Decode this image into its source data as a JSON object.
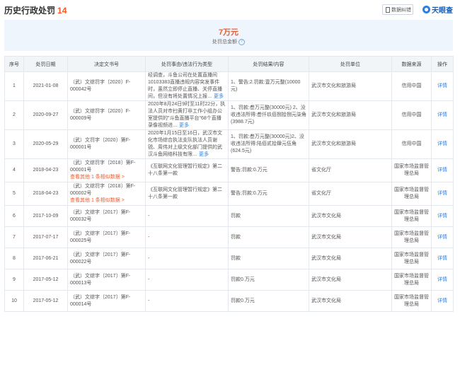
{
  "header": {
    "title": "历史行政处罚",
    "count": "14",
    "report_button": "数据纠错",
    "brand": "天眼查"
  },
  "summary": {
    "amount": "7万元",
    "label": "处罚总金额"
  },
  "table": {
    "columns": [
      "序号",
      "处罚日期",
      "决定文书号",
      "处罚事由/违法行为类型",
      "处罚结果/内容",
      "处罚单位",
      "数据来源",
      "操作"
    ],
    "rows": [
      {
        "idx": "1",
        "date": "2021-01-08",
        "docno": "（武）文综罚字〔2020〕F-000042号",
        "docno_extra": "",
        "reason": "经调查，斗鱼公司在处置直播间10103383直播违规内容突发事件时，虽然立即停止直播、关停直播间，但没有将处置情况上报…",
        "reason_more": "更多",
        "result": "1、警告;2.罚款:壹万元整(10000元)",
        "unit": "武汉市文化和旅游局",
        "source": "信用中国",
        "op": "详情"
      },
      {
        "idx": "2",
        "date": "2020-09-27",
        "docno": "（武）文综罚字〔2020〕F-000009号",
        "docno_extra": "",
        "reason": "2020年8月24日9时至11时22分，执法人员对市扫黄打非工作小组办公室提供的\"斗鱼直播平台\"68个直播录像视频进…",
        "reason_more": "更多",
        "result": "1、罚款:叁万元整(30000元) 2、没收违法所得:叁仟玖佰捌拾捌元柒角(3988.7元)",
        "unit": "武汉市文化和旅游局",
        "source": "信用中国",
        "op": "详情"
      },
      {
        "idx": "3",
        "date": "2020-05-29",
        "docno": "（武）文罚字〔2020〕第F-000001号",
        "docno_extra": "",
        "reason": "2020年1月15日至16日，武汉市文化市场综合执法支队执法人员谢锐、周伟对上级文化部门提供的武汉斗鱼网络科技有限…",
        "reason_more": "更多",
        "result": "1、罚款:叁万元整(30000元)2、没收违法所得:陆佰贰拾肆元伍角(624.5元)",
        "unit": "武汉市文化和旅游局",
        "source": "信用中国",
        "op": "详情"
      },
      {
        "idx": "4",
        "date": "2018-04-23",
        "docno": "（武）文综罚字〔2018〕第F-000001号",
        "docno_extra": "查看其他 1 条相似数据 >",
        "reason": "《互联网文化管理暂行规定》第二十八条第一款",
        "reason_more": "",
        "result": "警告;罚款:0.万元",
        "unit": "省文化厅",
        "source": "国家市场监督管理总局",
        "op": "详情"
      },
      {
        "idx": "5",
        "date": "2018-04-23",
        "docno": "（武）文综罚字〔2018〕第F-000002号",
        "docno_extra": "查看其他 1 条相似数据 >",
        "reason": "《互联网文化管理暂行规定》第二十八条第一款",
        "reason_more": "",
        "result": "警告;罚款:0.万元",
        "unit": "省文化厅",
        "source": "国家市场监督管理总局",
        "op": "详情"
      },
      {
        "idx": "6",
        "date": "2017-10-09",
        "docno": "（武）文综字〔2017〕第F-000032号",
        "docno_extra": "",
        "reason": "-",
        "reason_more": "",
        "result": "罚款",
        "unit": "武汉市文化局",
        "source": "国家市场监督管理总局",
        "op": "详情"
      },
      {
        "idx": "7",
        "date": "2017-07-17",
        "docno": "（武）文综字〔2017〕第F-000025号",
        "docno_extra": "",
        "reason": "-",
        "reason_more": "",
        "result": "罚款",
        "unit": "武汉市文化局",
        "source": "国家市场监督管理总局",
        "op": "详情"
      },
      {
        "idx": "8",
        "date": "2017-06-21",
        "docno": "（武）文综字〔2017〕第F-000022号",
        "docno_extra": "",
        "reason": "-",
        "reason_more": "",
        "result": "罚款",
        "unit": "武汉市文化局",
        "source": "国家市场监督管理总局",
        "op": "详情"
      },
      {
        "idx": "9",
        "date": "2017-05-12",
        "docno": "（武）文综字〔2017〕第F-000013号",
        "docno_extra": "",
        "reason": "-",
        "reason_more": "",
        "result": "罚款0.万元",
        "unit": "武汉市文化局",
        "source": "国家市场监督管理总局",
        "op": "详情"
      },
      {
        "idx": "10",
        "date": "2017-05-12",
        "docno": "（武）文综字〔2017〕第F-000014号",
        "docno_extra": "",
        "reason": "-",
        "reason_more": "",
        "result": "罚款0.万元",
        "unit": "武汉市文化局",
        "source": "国家市场监督管理总局",
        "op": "详情"
      }
    ]
  },
  "colors": {
    "accent_orange": "#f05a2a",
    "link_blue": "#2d7fe5",
    "summary_bg": "#eef5fc",
    "header_bg": "#f2f5f8"
  }
}
